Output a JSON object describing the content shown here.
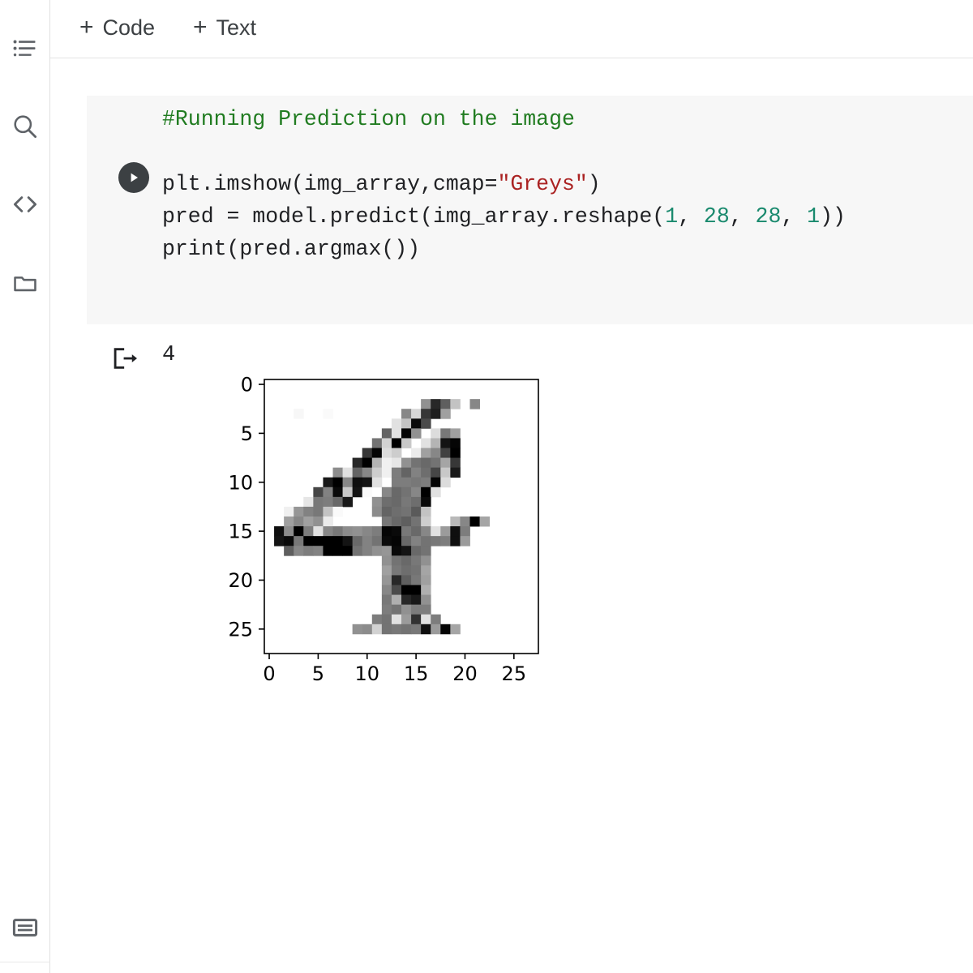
{
  "toolbar": {
    "add_code_label": "Code",
    "add_text_label": "Text",
    "plus_glyph": "+"
  },
  "sidebar": {
    "items": [
      {
        "name": "table-of-contents",
        "icon": "list-icon"
      },
      {
        "name": "search",
        "icon": "search-icon"
      },
      {
        "name": "code-snippets",
        "icon": "code-brackets-icon"
      },
      {
        "name": "files",
        "icon": "folder-icon"
      }
    ],
    "bottom_item": {
      "name": "terminal",
      "icon": "terminal-icon"
    }
  },
  "cell": {
    "run_button_icon": "play-icon",
    "background_color": "#f7f7f7",
    "code_lines": [
      [
        {
          "t": "#Running Prediction on the image",
          "c": "comment"
        }
      ],
      [
        {
          "t": "",
          "c": "plain"
        }
      ],
      [
        {
          "t": "plt.imshow(img_array,cmap=",
          "c": "plain"
        },
        {
          "t": "\"Greys\"",
          "c": "string"
        },
        {
          "t": ")",
          "c": "plain"
        }
      ],
      [
        {
          "t": "pred = model.predict(img_array.reshape(",
          "c": "plain"
        },
        {
          "t": "1",
          "c": "number"
        },
        {
          "t": ", ",
          "c": "plain"
        },
        {
          "t": "28",
          "c": "number"
        },
        {
          "t": ", ",
          "c": "plain"
        },
        {
          "t": "28",
          "c": "number"
        },
        {
          "t": ", ",
          "c": "plain"
        },
        {
          "t": "1",
          "c": "number"
        },
        {
          "t": "))",
          "c": "plain"
        }
      ],
      [
        {
          "t": "print(pred.argmax())",
          "c": "plain"
        }
      ]
    ]
  },
  "output": {
    "marker_icon": "output-arrow-icon",
    "printed_value": "4"
  },
  "colors": {
    "comment": "#217c21",
    "string": "#aa2222",
    "number": "#1a8a6e",
    "plain": "#202124",
    "cell_bg": "#f7f7f7",
    "toolbar_text": "#3c4043",
    "axis": "#000000"
  },
  "chart_data": {
    "type": "heatmap",
    "title": "",
    "xlabel": "",
    "ylabel": "",
    "cmap": "Greys",
    "interpolation": "nearest",
    "xlim": [
      -0.5,
      27.5
    ],
    "ylim": [
      27.5,
      -0.5
    ],
    "xticks": [
      0,
      5,
      10,
      15,
      20,
      25
    ],
    "yticks": [
      0,
      5,
      10,
      15,
      20,
      25
    ],
    "xticklabels": [
      "0",
      "5",
      "10",
      "15",
      "20",
      "25"
    ],
    "yticklabels": [
      "0",
      "5",
      "10",
      "15",
      "20",
      "25"
    ],
    "grid": false,
    "legend": "none",
    "shape": [
      28,
      28
    ],
    "vmin": 0,
    "vmax": 255,
    "description": "MNIST handwritten digit 4 grayscale image, 28x28 pixels, Greys colormap (0=white, 255=black)",
    "predicted_label": 4,
    "values": [
      [
        0,
        0,
        0,
        0,
        0,
        0,
        0,
        0,
        0,
        0,
        0,
        0,
        0,
        0,
        0,
        0,
        0,
        0,
        0,
        0,
        0,
        0,
        0,
        0,
        0,
        0,
        0,
        0
      ],
      [
        0,
        0,
        0,
        0,
        0,
        0,
        0,
        0,
        0,
        0,
        0,
        0,
        0,
        0,
        0,
        0,
        0,
        0,
        0,
        0,
        0,
        0,
        0,
        0,
        0,
        0,
        0,
        0
      ],
      [
        0,
        0,
        0,
        0,
        0,
        0,
        0,
        0,
        0,
        0,
        0,
        0,
        0,
        0,
        0,
        0,
        110,
        215,
        160,
        60,
        0,
        120,
        0,
        0,
        0,
        0,
        0,
        0
      ],
      [
        0,
        0,
        0,
        8,
        0,
        0,
        5,
        0,
        0,
        0,
        0,
        0,
        0,
        0,
        120,
        40,
        200,
        225,
        95,
        0,
        0,
        0,
        0,
        0,
        0,
        0,
        0,
        0
      ],
      [
        0,
        0,
        0,
        0,
        0,
        0,
        0,
        0,
        0,
        0,
        0,
        0,
        0,
        30,
        60,
        245,
        180,
        0,
        0,
        0,
        0,
        0,
        0,
        0,
        0,
        0,
        0,
        0
      ],
      [
        0,
        0,
        0,
        0,
        0,
        0,
        0,
        0,
        0,
        0,
        0,
        0,
        155,
        30,
        250,
        110,
        0,
        35,
        135,
        95,
        0,
        0,
        0,
        0,
        0,
        0,
        0
      ],
      [
        0,
        0,
        0,
        0,
        0,
        0,
        0,
        0,
        0,
        0,
        0,
        140,
        45,
        255,
        55,
        0,
        30,
        75,
        235,
        250,
        0,
        0,
        0,
        0,
        0,
        0,
        0
      ],
      [
        0,
        0,
        0,
        0,
        0,
        0,
        0,
        0,
        0,
        0,
        200,
        250,
        35,
        50,
        0,
        20,
        95,
        120,
        190,
        255,
        0,
        0,
        0,
        0,
        0,
        0,
        0
      ],
      [
        0,
        0,
        0,
        0,
        0,
        0,
        0,
        0,
        0,
        215,
        255,
        75,
        15,
        25,
        110,
        140,
        150,
        140,
        90,
        200,
        0,
        0,
        0,
        0,
        0,
        0,
        0
      ],
      [
        0,
        0,
        0,
        0,
        0,
        0,
        0,
        115,
        30,
        155,
        120,
        50,
        15,
        130,
        155,
        125,
        145,
        185,
        55,
        230,
        0,
        0,
        0,
        0,
        0,
        0,
        0
      ],
      [
        0,
        0,
        0,
        0,
        0,
        0,
        230,
        255,
        120,
        240,
        235,
        30,
        0,
        130,
        130,
        135,
        130,
        250,
        35,
        0,
        0,
        0,
        0,
        0,
        0,
        0,
        0
      ],
      [
        0,
        0,
        0,
        0,
        0,
        185,
        125,
        245,
        55,
        235,
        5,
        0,
        120,
        150,
        140,
        120,
        255,
        30,
        0,
        0,
        0,
        0,
        0,
        0,
        0,
        0,
        0
      ],
      [
        0,
        0,
        0,
        0,
        25,
        135,
        130,
        150,
        230,
        0,
        0,
        110,
        145,
        150,
        135,
        145,
        245,
        0,
        0,
        0,
        0,
        0,
        0,
        0,
        0,
        0,
        0
      ],
      [
        0,
        0,
        15,
        105,
        125,
        135,
        60,
        5,
        0,
        0,
        0,
        115,
        155,
        145,
        140,
        165,
        60,
        0,
        0,
        0,
        0,
        0,
        0,
        0,
        0,
        0,
        0
      ],
      [
        0,
        0,
        95,
        120,
        95,
        110,
        20,
        0,
        0,
        0,
        0,
        0,
        135,
        150,
        160,
        140,
        50,
        0,
        0,
        70,
        120,
        255,
        90,
        0,
        0,
        0,
        0
      ],
      [
        0,
        240,
        115,
        255,
        130,
        30,
        120,
        135,
        115,
        110,
        120,
        130,
        250,
        245,
        135,
        150,
        120,
        30,
        100,
        240,
        130,
        0,
        0,
        0,
        0,
        0,
        0
      ],
      [
        0,
        235,
        245,
        135,
        255,
        255,
        255,
        255,
        235,
        150,
        125,
        140,
        245,
        250,
        150,
        125,
        140,
        135,
        130,
        240,
        100,
        0,
        0,
        0,
        0,
        0,
        0
      ],
      [
        0,
        0,
        160,
        120,
        130,
        125,
        255,
        255,
        255,
        140,
        125,
        110,
        105,
        245,
        235,
        150,
        140,
        0,
        0,
        0,
        0,
        0,
        0,
        0,
        0,
        0,
        0
      ],
      [
        0,
        0,
        0,
        0,
        0,
        0,
        0,
        0,
        0,
        0,
        0,
        0,
        110,
        140,
        150,
        135,
        110,
        0,
        0,
        0,
        0,
        0,
        0,
        0,
        0,
        0,
        0
      ],
      [
        0,
        0,
        0,
        0,
        0,
        0,
        0,
        0,
        0,
        0,
        0,
        0,
        95,
        135,
        145,
        140,
        90,
        0,
        0,
        0,
        0,
        0,
        0,
        0,
        0,
        0,
        0
      ],
      [
        0,
        0,
        0,
        0,
        0,
        0,
        0,
        0,
        0,
        0,
        0,
        0,
        105,
        215,
        160,
        135,
        95,
        0,
        0,
        0,
        0,
        0,
        0,
        0,
        0,
        0,
        0
      ],
      [
        0,
        0,
        0,
        0,
        0,
        0,
        0,
        0,
        0,
        0,
        0,
        0,
        120,
        180,
        255,
        255,
        80,
        0,
        0,
        0,
        0,
        0,
        0,
        0,
        0,
        0,
        0
      ],
      [
        0,
        0,
        0,
        0,
        0,
        0,
        0,
        0,
        0,
        0,
        0,
        0,
        135,
        80,
        215,
        230,
        110,
        0,
        0,
        0,
        0,
        0,
        0,
        0,
        0,
        0,
        0
      ],
      [
        0,
        0,
        0,
        0,
        0,
        0,
        0,
        0,
        0,
        0,
        0,
        0,
        130,
        140,
        110,
        130,
        130,
        0,
        0,
        0,
        0,
        0,
        0,
        0,
        0,
        0,
        0
      ],
      [
        0,
        0,
        0,
        0,
        0,
        0,
        0,
        0,
        0,
        0,
        0,
        130,
        140,
        30,
        100,
        205,
        30,
        130,
        0,
        0,
        0,
        0,
        0,
        0,
        0,
        0,
        0
      ],
      [
        0,
        0,
        0,
        0,
        0,
        0,
        0,
        0,
        0,
        110,
        115,
        45,
        140,
        135,
        140,
        135,
        240,
        100,
        250,
        90,
        0,
        0,
        0,
        0,
        0,
        0,
        0
      ],
      [
        0,
        0,
        0,
        0,
        0,
        0,
        0,
        0,
        0,
        0,
        0,
        0,
        0,
        0,
        0,
        0,
        0,
        0,
        0,
        0,
        0,
        0,
        0,
        0,
        0,
        0,
        0,
        0
      ],
      [
        0,
        0,
        0,
        0,
        0,
        0,
        0,
        0,
        0,
        0,
        0,
        0,
        0,
        0,
        0,
        0,
        0,
        0,
        0,
        0,
        0,
        0,
        0,
        0,
        0,
        0,
        0,
        0
      ]
    ]
  }
}
